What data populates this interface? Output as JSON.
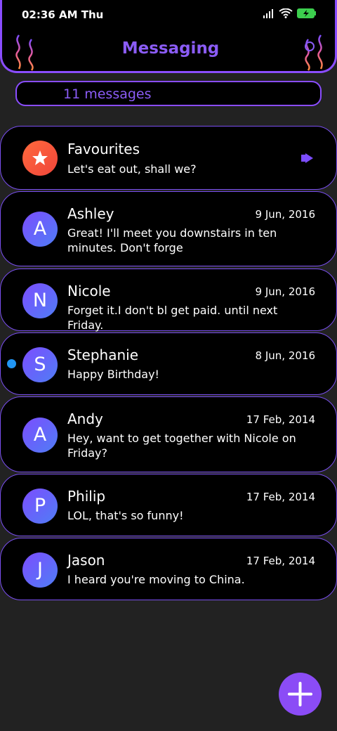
{
  "status_bar": {
    "time": "02:36 AM Thu"
  },
  "header": {
    "title": "Messaging"
  },
  "count": {
    "label": "11 messages"
  },
  "conversations": [
    {
      "avatar": "★",
      "name": "Favourites",
      "date": "",
      "message": "Let's eat out, shall we?",
      "unread": false,
      "favourite": true
    },
    {
      "avatar": "A",
      "name": "Ashley",
      "date": "9 Jun, 2016",
      "message": "Great! I'll meet you downstairs in ten minutes. Don't forge",
      "unread": false
    },
    {
      "avatar": "N",
      "name": "Nicole",
      "date": "9 Jun, 2016",
      "message": "Forget it.I don't bl get paid. until next Friday.",
      "unread": false
    },
    {
      "avatar": "S",
      "name": "Stephanie",
      "date": "8 Jun, 2016",
      "message": "Happy Birthday!",
      "unread": true
    },
    {
      "avatar": "A",
      "name": "Andy",
      "date": "17 Feb, 2014",
      "message": "Hey, want to get together with Nicole on Friday?",
      "unread": false
    },
    {
      "avatar": "P",
      "name": "Philip",
      "date": "17 Feb, 2014",
      "message": "LOL, that's so funny!",
      "unread": false
    },
    {
      "avatar": "J",
      "name": "Jason",
      "date": "17 Feb, 2014",
      "message": "I heard you're moving to China.",
      "unread": false
    }
  ],
  "fab": {
    "icon": "plus-icon"
  },
  "colors": {
    "accent": "#8b5cf6",
    "background": "#222222",
    "card": "#000000",
    "unread": "#2196f3",
    "favourite": "#f0453a"
  }
}
